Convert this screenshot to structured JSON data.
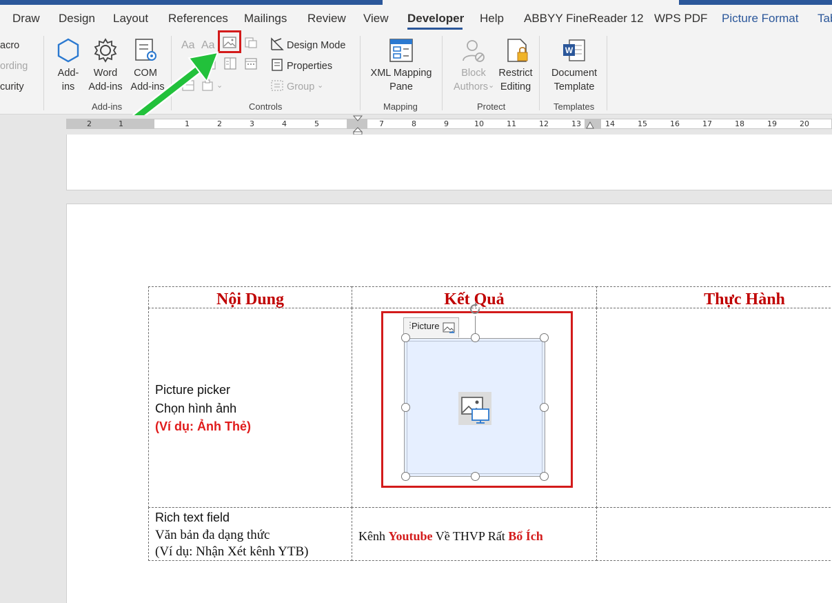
{
  "tabs": {
    "draw": "Draw",
    "design": "Design",
    "layout": "Layout",
    "references": "References",
    "mailings": "Mailings",
    "review": "Review",
    "view": "View",
    "developer": "Developer",
    "help": "Help",
    "abbyy": "ABBYY FineReader 12",
    "wps": "WPS PDF",
    "picture_format": "Picture Format",
    "tab_cut": "Tab"
  },
  "ribbon": {
    "code": {
      "macro": "acro",
      "recording": "ording",
      "security": "curity"
    },
    "addins": {
      "addins_line1": "Add-",
      "addins_line2": "ins",
      "word_line1": "Word",
      "word_line2": "Add-ins",
      "com_line1": "COM",
      "com_line2": "Add-ins",
      "label": "Add-ins"
    },
    "controls": {
      "design_mode": "Design Mode",
      "properties": "Properties",
      "group": "Group",
      "label": "Controls",
      "aa1": "Aa",
      "aa2": "Aa"
    },
    "mapping": {
      "line1": "XML Mapping",
      "line2": "Pane",
      "label": "Mapping"
    },
    "protect": {
      "block_line1": "Block",
      "block_line2": "Authors",
      "restrict_line1": "Restrict",
      "restrict_line2": "Editing",
      "label": "Protect"
    },
    "templates": {
      "line1": "Document",
      "line2": "Template",
      "label": "Templates"
    }
  },
  "ruler": {
    "numbers": [
      "2",
      "1",
      "1",
      "1",
      "2",
      "3",
      "4",
      "5",
      "7",
      "8",
      "9",
      "10",
      "11",
      "12",
      "13",
      "14",
      "15",
      "16",
      "17",
      "18",
      "19",
      "20"
    ]
  },
  "table": {
    "headers": [
      "Nội Dung",
      "Kết Quả",
      "Thực Hành"
    ],
    "row1": {
      "line1": "Picture picker",
      "line2": "Chọn hình ảnh",
      "line3": "(Ví dụ: Ảnh Thẻ)",
      "picture_tag": "Picture"
    },
    "row2": {
      "line1": "Rich text field",
      "line2": "Văn bản đa dạng thức",
      "line3": "(Ví dụ: Nhận Xét kênh YTB)",
      "result_p1": "Kênh ",
      "result_p2": "Youtube",
      "result_p3": " Về THVP Rất ",
      "result_p4": "Bổ Ích"
    }
  },
  "colors": {
    "accent": "#2b579a",
    "highlight_box": "#d31b1b",
    "arrow": "#22c13b",
    "header_red": "#c00000",
    "picture_fill": "#e6efff"
  },
  "icons": [
    "add-ins-icon",
    "gear-icon",
    "com-addins-icon",
    "picture-control-icon",
    "design-mode-icon",
    "properties-icon",
    "group-icon",
    "xml-mapping-icon",
    "block-authors-icon",
    "restrict-editing-icon",
    "document-template-icon",
    "picture-placeholder-icon",
    "rotate-handle-icon"
  ]
}
